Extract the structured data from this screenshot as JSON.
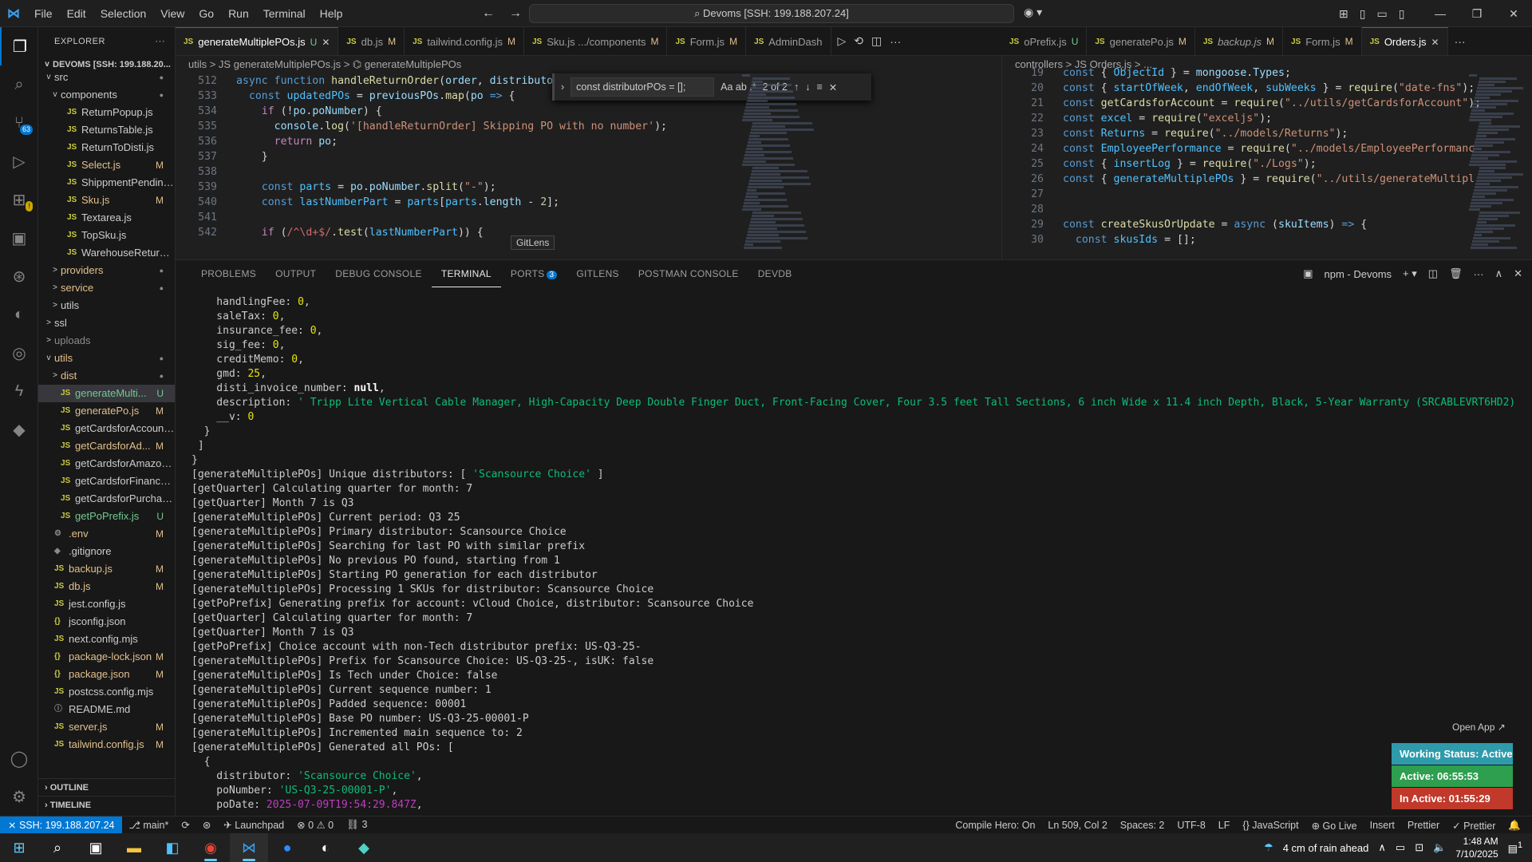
{
  "menu": [
    "File",
    "Edit",
    "Selection",
    "View",
    "Go",
    "Run",
    "Terminal",
    "Help"
  ],
  "command_center": "Devoms [SSH: 199.188.207.24]",
  "explorer": {
    "title": "EXPLORER",
    "root": "DEVOMS [SSH: 199.188.20...",
    "items": [
      {
        "label": "src",
        "indent": 1,
        "twisty": "v",
        "icon": "",
        "status": "dot",
        "cls": "dot"
      },
      {
        "label": "components",
        "indent": 2,
        "twisty": "v",
        "icon": "",
        "status": "dot",
        "cls": "dot"
      },
      {
        "label": "ReturnPopup.js",
        "indent": 3,
        "twisty": "",
        "icon": "JS",
        "status": "",
        "cls": ""
      },
      {
        "label": "ReturnsTable.js",
        "indent": 3,
        "twisty": "",
        "icon": "JS",
        "status": "",
        "cls": ""
      },
      {
        "label": "ReturnToDisti.js",
        "indent": 3,
        "twisty": "",
        "icon": "JS",
        "status": "",
        "cls": ""
      },
      {
        "label": "Select.js",
        "indent": 3,
        "twisty": "",
        "icon": "JS",
        "status": "M",
        "cls": "mod"
      },
      {
        "label": "ShippmentPending...",
        "indent": 3,
        "twisty": "",
        "icon": "JS",
        "status": "",
        "cls": ""
      },
      {
        "label": "Sku.js",
        "indent": 3,
        "twisty": "",
        "icon": "JS",
        "status": "M",
        "cls": "mod"
      },
      {
        "label": "Textarea.js",
        "indent": 3,
        "twisty": "",
        "icon": "JS",
        "status": "",
        "cls": ""
      },
      {
        "label": "TopSku.js",
        "indent": 3,
        "twisty": "",
        "icon": "JS",
        "status": "",
        "cls": ""
      },
      {
        "label": "WarehouseReturn.js",
        "indent": 3,
        "twisty": "",
        "icon": "JS",
        "status": "",
        "cls": ""
      },
      {
        "label": "providers",
        "indent": 2,
        "twisty": ">",
        "icon": "",
        "status": "dot",
        "cls": "mod dot"
      },
      {
        "label": "service",
        "indent": 2,
        "twisty": ">",
        "icon": "",
        "status": "dot",
        "cls": "mod dot"
      },
      {
        "label": "utils",
        "indent": 2,
        "twisty": ">",
        "icon": "",
        "status": "",
        "cls": ""
      },
      {
        "label": "ssl",
        "indent": 1,
        "twisty": ">",
        "icon": "",
        "status": "",
        "cls": ""
      },
      {
        "label": "uploads",
        "indent": 1,
        "twisty": ">",
        "icon": "",
        "status": "",
        "cls": "dim"
      },
      {
        "label": "utils",
        "indent": 1,
        "twisty": "v",
        "icon": "",
        "status": "dot",
        "cls": "mod dot"
      },
      {
        "label": "dist",
        "indent": 2,
        "twisty": ">",
        "icon": "",
        "status": "dot",
        "cls": "mod dot"
      },
      {
        "label": "generateMulti...",
        "indent": 2,
        "twisty": "",
        "icon": "JS",
        "status": "U",
        "cls": "unt sel"
      },
      {
        "label": "generatePo.js",
        "indent": 2,
        "twisty": "",
        "icon": "JS",
        "status": "M",
        "cls": "mod"
      },
      {
        "label": "getCardsforAccount.js",
        "indent": 2,
        "twisty": "",
        "icon": "JS",
        "status": "",
        "cls": ""
      },
      {
        "label": "getCardsforAd...",
        "indent": 2,
        "twisty": "",
        "icon": "JS",
        "status": "M",
        "cls": "mod"
      },
      {
        "label": "getCardsforAmazon.js",
        "indent": 2,
        "twisty": "",
        "icon": "JS",
        "status": "",
        "cls": ""
      },
      {
        "label": "getCardsforFinance.js",
        "indent": 2,
        "twisty": "",
        "icon": "JS",
        "status": "",
        "cls": ""
      },
      {
        "label": "getCardsforPurchasi...",
        "indent": 2,
        "twisty": "",
        "icon": "JS",
        "status": "",
        "cls": ""
      },
      {
        "label": "getPoPrefix.js",
        "indent": 2,
        "twisty": "",
        "icon": "JS",
        "status": "U",
        "cls": "unt"
      },
      {
        "label": ".env",
        "indent": 1,
        "twisty": "",
        "icon": "⚙",
        "status": "M",
        "cls": "mod"
      },
      {
        "label": ".gitignore",
        "indent": 1,
        "twisty": "",
        "icon": "◆",
        "status": "",
        "cls": ""
      },
      {
        "label": "backup.js",
        "indent": 1,
        "twisty": "",
        "icon": "JS",
        "status": "M",
        "cls": "mod"
      },
      {
        "label": "db.js",
        "indent": 1,
        "twisty": "",
        "icon": "JS",
        "status": "M",
        "cls": "mod"
      },
      {
        "label": "jest.config.js",
        "indent": 1,
        "twisty": "",
        "icon": "JS",
        "status": "",
        "cls": ""
      },
      {
        "label": "jsconfig.json",
        "indent": 1,
        "twisty": "",
        "icon": "{}",
        "status": "",
        "cls": ""
      },
      {
        "label": "next.config.mjs",
        "indent": 1,
        "twisty": "",
        "icon": "JS",
        "status": "",
        "cls": ""
      },
      {
        "label": "package-lock.json",
        "indent": 1,
        "twisty": "",
        "icon": "{}",
        "status": "M",
        "cls": "mod"
      },
      {
        "label": "package.json",
        "indent": 1,
        "twisty": "",
        "icon": "{}",
        "status": "M",
        "cls": "mod"
      },
      {
        "label": "postcss.config.mjs",
        "indent": 1,
        "twisty": "",
        "icon": "JS",
        "status": "",
        "cls": ""
      },
      {
        "label": "README.md",
        "indent": 1,
        "twisty": "",
        "icon": "ⓘ",
        "status": "",
        "cls": ""
      },
      {
        "label": "server.js",
        "indent": 1,
        "twisty": "",
        "icon": "JS",
        "status": "M",
        "cls": "mod"
      },
      {
        "label": "tailwind.config.js",
        "indent": 1,
        "twisty": "",
        "icon": "JS",
        "status": "M",
        "cls": "mod"
      }
    ],
    "outline": "OUTLINE",
    "timeline": "TIMELINE"
  },
  "tabs_left": [
    {
      "label": "generateMultiplePOs.js",
      "status": "U",
      "active": true,
      "close": true,
      "italic": false
    },
    {
      "label": "db.js",
      "status": "M",
      "active": false,
      "close": false,
      "italic": false
    },
    {
      "label": "tailwind.config.js",
      "status": "M",
      "active": false,
      "close": false,
      "italic": false
    },
    {
      "label": "Sku.js .../components",
      "status": "M",
      "active": false,
      "close": false,
      "italic": false
    },
    {
      "label": "Form.js",
      "status": "M",
      "active": false,
      "close": false,
      "italic": false
    },
    {
      "label": "AdminDash",
      "status": "",
      "active": false,
      "close": false,
      "italic": false
    }
  ],
  "tabs_right": [
    {
      "label": "oPrefix.js",
      "status": "U",
      "active": false,
      "close": false,
      "italic": false
    },
    {
      "label": "generatePo.js",
      "status": "M",
      "active": false,
      "close": false,
      "italic": false
    },
    {
      "label": "backup.js",
      "status": "M",
      "active": false,
      "close": false,
      "italic": true
    },
    {
      "label": "Form.js",
      "status": "M",
      "active": false,
      "close": false,
      "italic": false
    },
    {
      "label": "Orders.js",
      "status": "",
      "active": true,
      "close": true,
      "italic": false
    }
  ],
  "editor_left": {
    "breadcrumb": "utils  >  JS generateMultiplePOs.js  >  ⌬ generateMultiplePOs",
    "find": {
      "query": "const distributorPOs = [];",
      "opts": "Aa  ab  .*",
      "result": "2 of 2"
    },
    "hover": "GitLens"
  },
  "editor_right": {
    "breadcrumb": "controllers  >  JS Orders.js  >  ..."
  },
  "panel": {
    "tabs": [
      "PROBLEMS",
      "OUTPUT",
      "DEBUG CONSOLE",
      "TERMINAL",
      "PORTS",
      "GITLENS",
      "POSTMAN CONSOLE",
      "DEVDB"
    ],
    "ports_badge": "3",
    "terminal_name": "npm - Devoms"
  },
  "overlay": {
    "open_app": "Open App ↗",
    "working_status": "Working Status: Active",
    "active": "Active: 06:55:53",
    "inactive": "In Active: 01:55:29",
    "colors": {
      "working": "#2e9bab",
      "active": "#2e9e4f",
      "inactive": "#c0392b"
    }
  },
  "statusbar": {
    "ssh": "⨯ SSH: 199.188.207.24",
    "branch": "⎇ main*",
    "launchpad": "Launchpad",
    "problems": "⊗ 0 ⚠ 0",
    "ports": "⛓ 3",
    "right": [
      "Compile Hero: On",
      "Ln 509, Col 2",
      "Spaces: 2",
      "UTF-8",
      "LF",
      "{} JavaScript",
      "⊕ Go Live",
      "Insert",
      "Prettier",
      "✓ Prettier"
    ]
  },
  "taskbar": {
    "weather": "4 cm of rain ahead",
    "time": "1:48 AM",
    "date": "7/10/2025",
    "notif": "1"
  }
}
